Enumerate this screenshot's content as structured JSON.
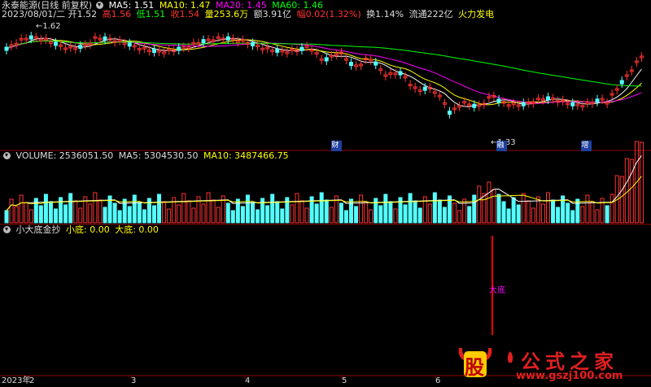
{
  "header": {
    "stock_name": "永泰能源(日线 前复权)",
    "ma5": "MA5: 1.51",
    "ma10": "MA10: 1.47",
    "ma20": "MA20: 1.45",
    "ma60": "MA60: 1.46",
    "date": "2023/08/01/二",
    "open": "开1.52",
    "high": "高1.56",
    "low": "低1.51",
    "close": "收1.54",
    "volume": "量253.6万",
    "amount": "额3.91亿",
    "change": "幅0.02(1.32%)",
    "turnover": "换1.14%",
    "float": "流通222亿",
    "concept": "火力发电"
  },
  "price_markers": {
    "high_label": "1.62",
    "low_label": "1.33"
  },
  "event_tags": [
    "财",
    "融",
    "增"
  ],
  "volume_header": {
    "volume": "VOLUME: 2536051.50",
    "ma5": "MA5: 5304530.50",
    "ma10": "MA10: 3487466.75"
  },
  "indicator_header": {
    "name": "小大底金抄",
    "small_bottom": "小底: 0.00",
    "big_bottom": "大底: 0.00"
  },
  "indicator_signal_label": "大底",
  "x_axis": {
    "year_label": "2023年",
    "months": [
      "2",
      "3",
      "4",
      "5",
      "6"
    ]
  },
  "watermark": {
    "char": "股",
    "title": "公式之家",
    "url": "www.gszj100.com"
  },
  "colors": {
    "up": "#ff3232",
    "down": "#54ffff",
    "ma5": "#ffffff",
    "ma10": "#ffff00",
    "ma20": "#ff00ff",
    "ma60": "#00ff00",
    "high": "#ff3232",
    "low": "#00ff00",
    "volume": "#ffffff",
    "signal": "#ff0000"
  }
}
